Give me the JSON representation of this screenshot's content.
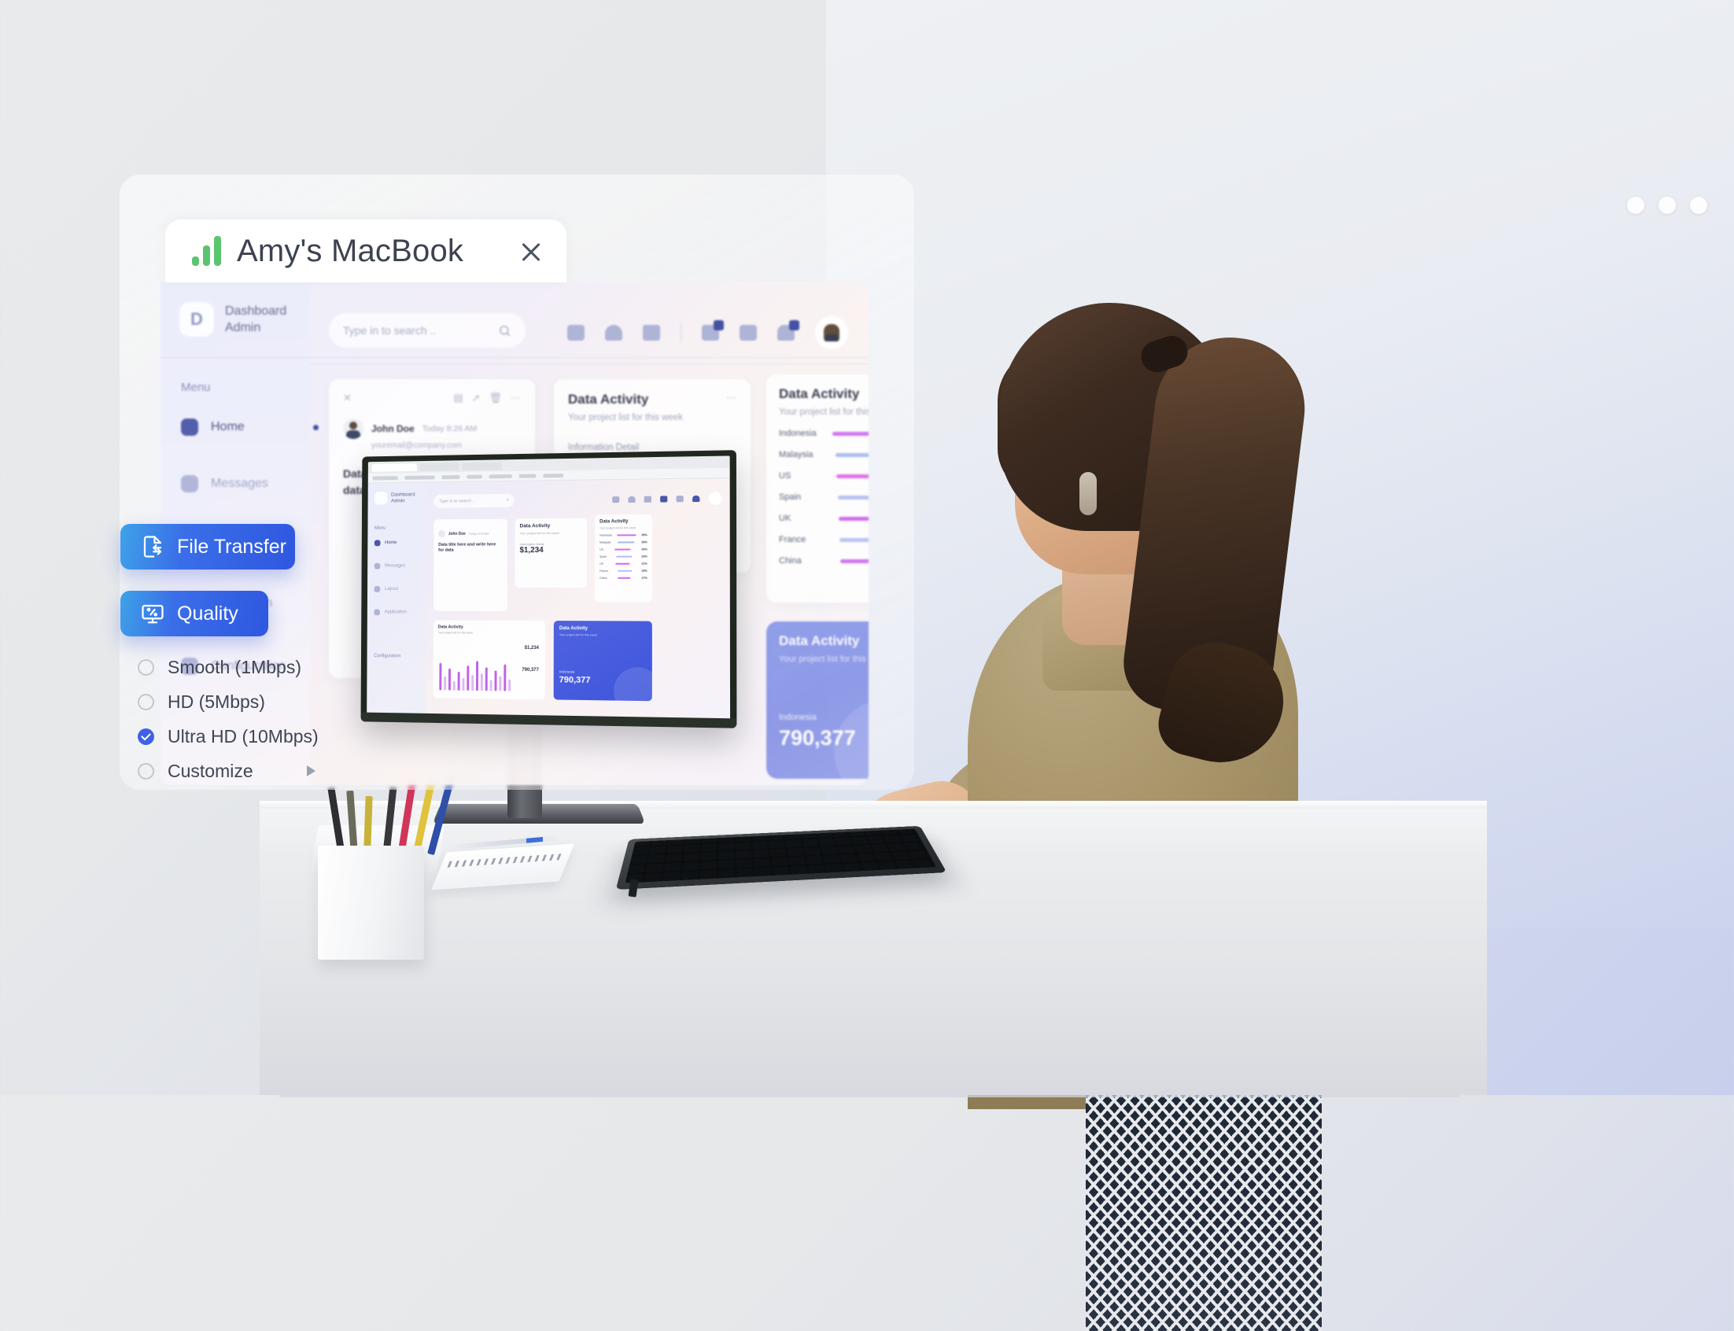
{
  "window": {
    "title": "Amy's MacBook",
    "logo_icon": "signal-bars-icon",
    "close_icon": "close-icon",
    "dots": [
      "dot-1",
      "dot-2",
      "dot-3"
    ]
  },
  "controls": {
    "file_transfer": {
      "label": "File Transfer",
      "icon": "file-transfer-icon"
    },
    "quality": {
      "label": "Quality",
      "icon": "monitor-quality-icon"
    },
    "quality_options": [
      {
        "label": "Smooth (1Mbps)",
        "selected": false,
        "submenu": false
      },
      {
        "label": "HD (5Mbps)",
        "selected": false,
        "submenu": false
      },
      {
        "label": "Ultra HD (10Mbps)",
        "selected": true,
        "submenu": false
      },
      {
        "label": "Customize",
        "selected": false,
        "submenu": true
      }
    ]
  },
  "dashboard": {
    "brand": {
      "mark": "D",
      "line1": "Dashboard",
      "line2": "Admin"
    },
    "search": {
      "placeholder": "Type in to search ..",
      "icon": "search-icon"
    },
    "header_icons": [
      "calendar-icon",
      "cloud-icon",
      "layers-icon",
      "messages-icon",
      "contacts-icon",
      "bell-icon"
    ],
    "avatar": "user-avatar",
    "menu_label": "Menu",
    "menu": [
      {
        "label": "Home",
        "icon": "home-icon",
        "active": true
      },
      {
        "label": "Messages",
        "icon": "message-icon",
        "active": false
      },
      {
        "label": "Layout",
        "icon": "layers-icon",
        "active": false
      },
      {
        "label": "Application",
        "icon": "grid-icon",
        "active": false
      },
      {
        "label": "Configuration",
        "icon": "settings-icon",
        "active": false
      }
    ],
    "mail_card": {
      "close_icon": "close-icon",
      "actions": [
        "archive-icon",
        "pin-icon",
        "trash-icon",
        "more-icon"
      ],
      "sender": "John Doe",
      "time": "Today 8:26 AM",
      "email": "youremail@company.com",
      "subject": "Data title here and write here for data"
    },
    "activity_card": {
      "title": "Data Activity",
      "subtitle": "Your project list for this week",
      "detail_label": "Information Detail",
      "amount": "$1,234",
      "more_icon": "more-icon"
    },
    "country_card": {
      "title": "Data Activity",
      "subtitle": "Your project list for this week"
    },
    "purple_card": {
      "title": "Data Activity",
      "subtitle": "Your project list for this week",
      "country": "Indonesia",
      "value": "790,377"
    }
  },
  "chart_data": {
    "type": "bar",
    "title": "Data Activity",
    "subtitle": "Your project list for this week",
    "categories": [
      "Indonesia",
      "Malaysia",
      "US",
      "Spain",
      "UK",
      "France",
      "China"
    ],
    "values": [
      35,
      28,
      26,
      23,
      21,
      19,
      17
    ],
    "value_labels": [
      "35%",
      "28%",
      "26%",
      "23%",
      "21%",
      "19%",
      "17%"
    ],
    "colors": [
      "#d06ef0",
      "#aab9f0",
      "#e06ae8",
      "#b3bdf2",
      "#cf66ef",
      "#b6c0f2",
      "#d06ef0"
    ],
    "xlabel": "",
    "ylabel": "",
    "ylim": [
      0,
      40
    ],
    "grid": false,
    "legend": "none"
  },
  "colors": {
    "accent_blue": "#3a6ee8",
    "accent_green": "#5bc46f",
    "purple_card": "#8d9ae8",
    "text_dark": "#3c4250"
  }
}
